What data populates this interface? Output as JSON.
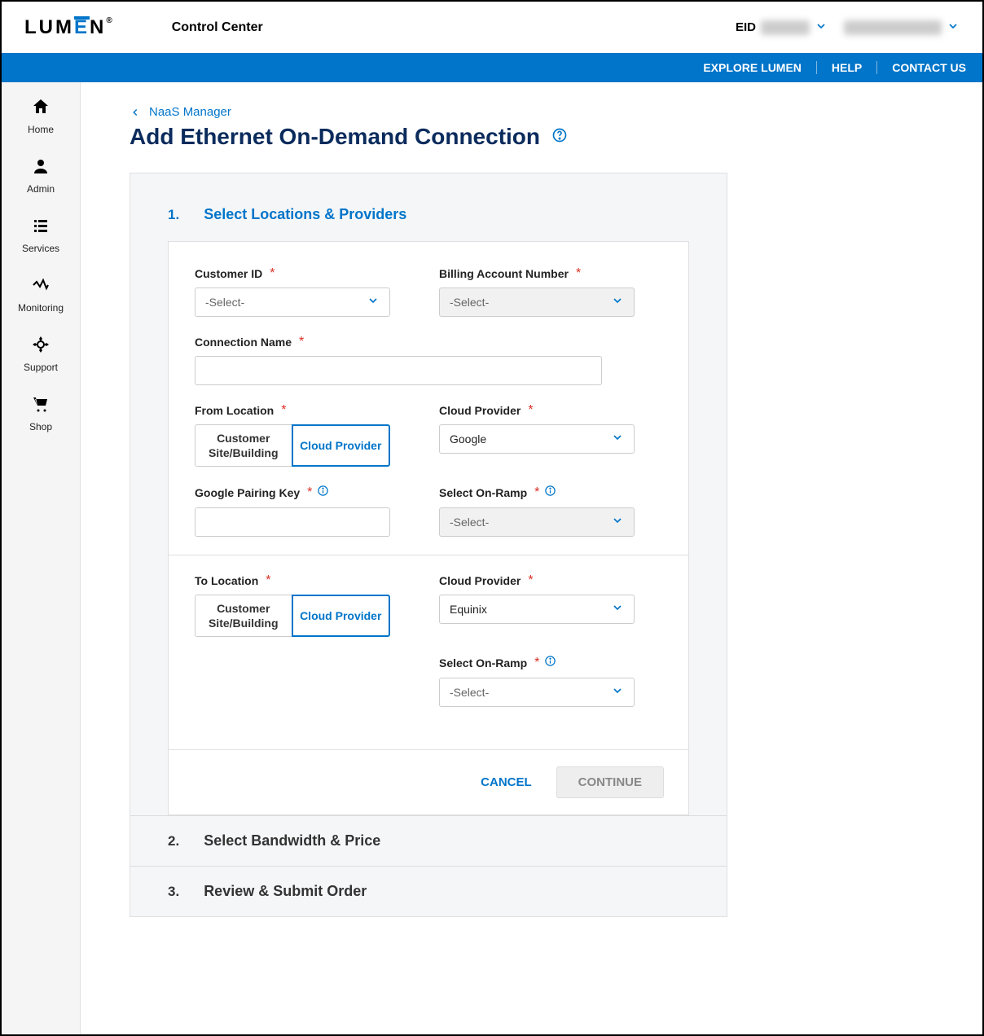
{
  "header": {
    "logo": "LUMEN",
    "app_title": "Control Center",
    "eid_label": "EID"
  },
  "top_nav": {
    "explore": "EXPLORE LUMEN",
    "help": "HELP",
    "contact": "CONTACT US"
  },
  "sidebar": {
    "items": [
      {
        "label": "Home"
      },
      {
        "label": "Admin"
      },
      {
        "label": "Services"
      },
      {
        "label": "Monitoring"
      },
      {
        "label": "Support"
      },
      {
        "label": "Shop"
      }
    ]
  },
  "breadcrumb": {
    "label": "NaaS Manager"
  },
  "page_title": "Add Ethernet On-Demand Connection",
  "step1": {
    "num": "1.",
    "title": "Select Locations & Providers",
    "customer_id_label": "Customer ID",
    "customer_id_placeholder": "-Select-",
    "billing_label": "Billing Account Number",
    "billing_placeholder": "-Select-",
    "connection_name_label": "Connection Name",
    "from_location_label": "From Location",
    "toggle_customer": "Customer Site/Building",
    "toggle_cloud": "Cloud Provider",
    "cloud_provider_label": "Cloud Provider",
    "cloud_provider_from_value": "Google",
    "google_key_label": "Google Pairing Key",
    "select_onramp_label": "Select On-Ramp",
    "select_onramp_placeholder": "-Select-",
    "to_location_label": "To Location",
    "cloud_provider_to_value": "Equinix",
    "select_onramp2_placeholder": "-Select-",
    "cancel": "CANCEL",
    "continue": "CONTINUE"
  },
  "step2": {
    "num": "2.",
    "title": "Select Bandwidth & Price"
  },
  "step3": {
    "num": "3.",
    "title": "Review & Submit Order"
  }
}
